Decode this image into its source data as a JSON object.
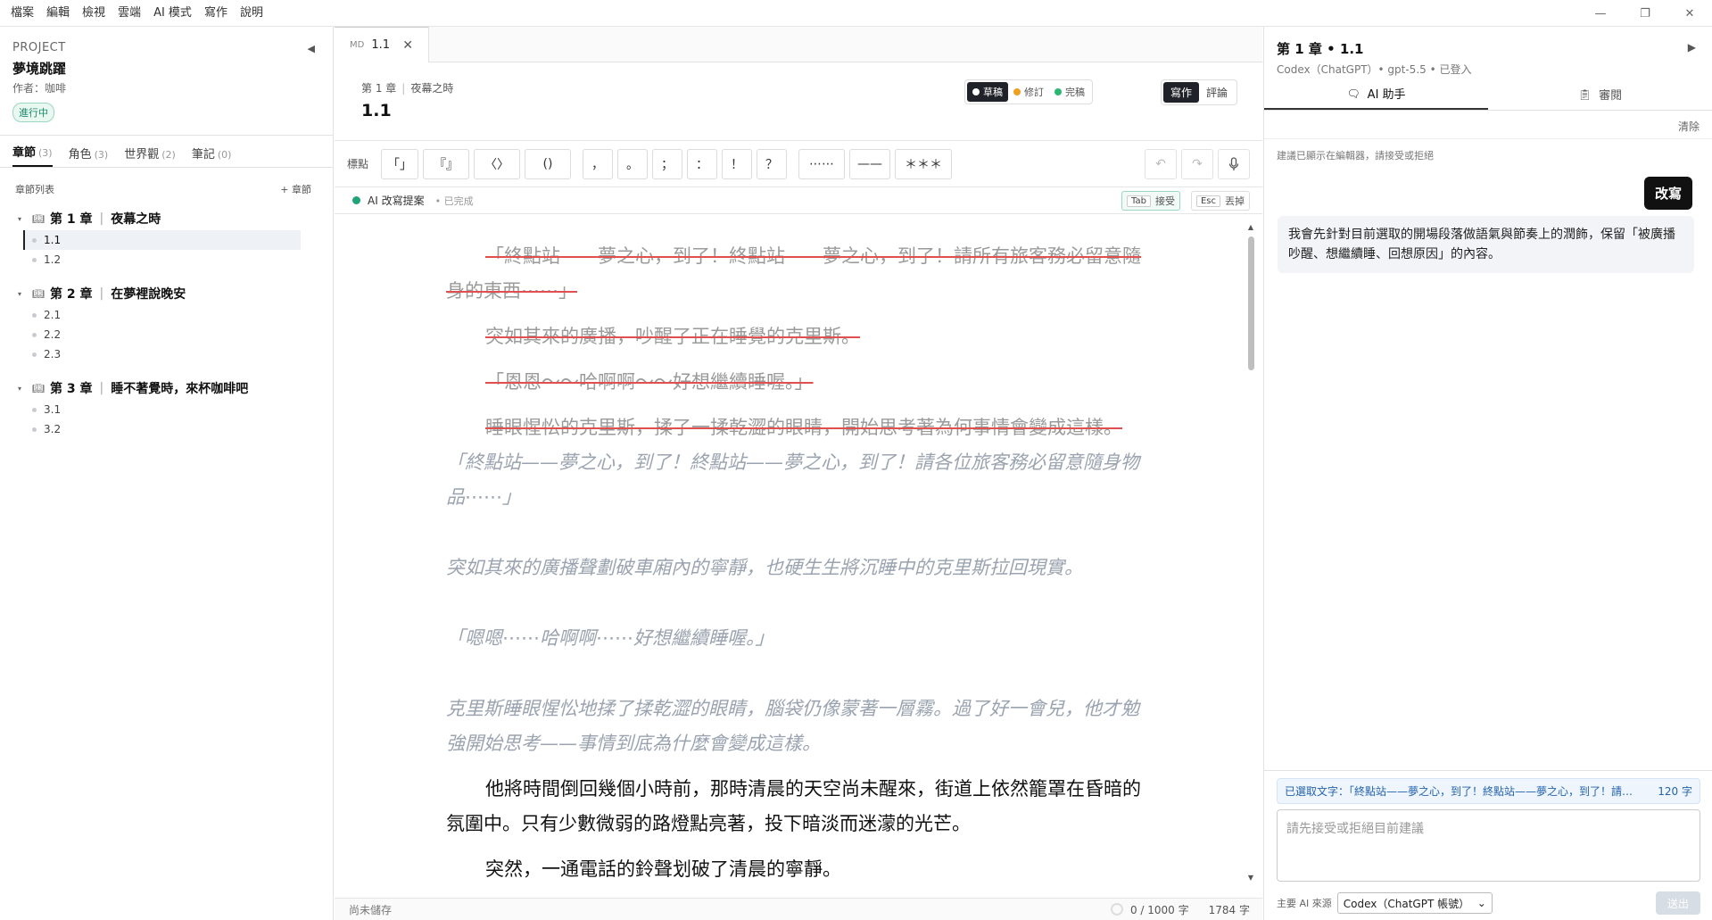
{
  "menu": [
    "檔案",
    "編輯",
    "檢視",
    "雲端",
    "AI 模式",
    "寫作",
    "說明"
  ],
  "window": {
    "minimize": "—",
    "restore": "❐",
    "close": "✕"
  },
  "project": {
    "label": "PROJECT",
    "title": "夢境跳躍",
    "author": "作者：咖啡",
    "status": "進行中"
  },
  "side_tabs": [
    {
      "label": "章節",
      "count": "(3)"
    },
    {
      "label": "角色",
      "count": "(3)"
    },
    {
      "label": "世界觀",
      "count": "(2)"
    },
    {
      "label": "筆記",
      "count": "(0)"
    }
  ],
  "chapter_list": {
    "title": "章節列表",
    "add": "+ 章節",
    "chapters": [
      {
        "num": "第 1 章",
        "name": "夜幕之時",
        "sections": [
          "1.1",
          "1.2"
        ]
      },
      {
        "num": "第 2 章",
        "name": "在夢裡說晚安",
        "sections": [
          "2.1",
          "2.2",
          "2.3"
        ]
      },
      {
        "num": "第 3 章",
        "name": "睡不著覺時，來杯咖啡吧",
        "sections": [
          "3.1",
          "3.2"
        ]
      }
    ]
  },
  "editor": {
    "tab_type": "MD",
    "tab_name": "1.1",
    "breadcrumb_chapter": "第 1 章",
    "breadcrumb_name": "夜幕之時",
    "doc_title": "1.1",
    "status": [
      {
        "label": "草稿",
        "color": "#ffffff"
      },
      {
        "label": "修訂",
        "color": "#f0a020"
      },
      {
        "label": "完稿",
        "color": "#2bb673"
      }
    ],
    "modes": [
      "寫作",
      "評論"
    ],
    "punct_label": "標點",
    "punct": [
      "「」",
      "『』",
      "〈〉",
      "()",
      "，",
      "。",
      "；",
      "：",
      "！",
      "？",
      "⋯⋯",
      "——",
      "＊＊＊"
    ],
    "ai_bar": {
      "label": "AI 改寫提案",
      "done": "• 已完成",
      "accept_key": "Tab",
      "accept": "接受",
      "reject_key": "Esc",
      "reject": "丟掉"
    },
    "paragraphs": {
      "del1": "「終點站——夢之心，到了！終點站——夢之心，到了！請所有旅客務必留意隨身的東西⋯⋯」",
      "del2": "突如其來的廣播，吵醒了正在睡覺的克里斯。",
      "del3": "「恩恩～～哈啊啊～～好想繼續睡喔。」",
      "del4": "睡眼惺忪的克里斯，揉了一揉乾澀的眼睛，開始思考著為何事情會變成這樣。",
      "ins1": "「終點站——夢之心，到了！終點站——夢之心，到了！請各位旅客務必留意隨身物品⋯⋯」",
      "ins2": "突如其來的廣播聲劃破車廂內的寧靜，也硬生生將沉睡中的克里斯拉回現實。",
      "ins3": "「嗯嗯⋯⋯哈啊啊⋯⋯好想繼續睡喔。」",
      "ins4": "克里斯睡眼惺忪地揉了揉乾澀的眼睛，腦袋仍像蒙著一層霧。過了好一會兒，他才勉強開始思考——事情到底為什麼會變成這樣。",
      "plain1": "他將時間倒回幾個小時前，那時清晨的天空尚未醒來，街道上依然籠罩在昏暗的氛圍中。只有少數微弱的路燈點亮著，投下暗淡而迷濛的光芒。",
      "plain2": "突然，一通電話的鈴聲划破了清晨的寧靜。"
    },
    "status_bar": {
      "unsaved": "尚未儲存",
      "goal": "0 / 1000 字",
      "count": "1784 字"
    }
  },
  "panel": {
    "title": "第 1 章 • 1.1",
    "subtitle": "Codex（ChatGPT）• gpt-5.5 • 已登入",
    "tabs": [
      "AI 助手",
      "審閱"
    ],
    "clear": "清除",
    "hint": "建議已顯示在編輯器，請接受或拒絕",
    "user_msg": "改寫",
    "ai_msg": "我會先針對目前選取的開場段落做語氣與節奏上的潤飾，保留「被廣播吵醒、想繼續睡、回想原因」的內容。",
    "selected_text": "已選取文字：「終點站——夢之心，到了！終點站——夢之心，到了！請所⋯",
    "selected_count": "120 字",
    "input_placeholder": "請先接受或拒絕目前建議",
    "source_label": "主要 AI 來源",
    "source_value": "Codex（ChatGPT 帳號）",
    "send": "送出"
  }
}
